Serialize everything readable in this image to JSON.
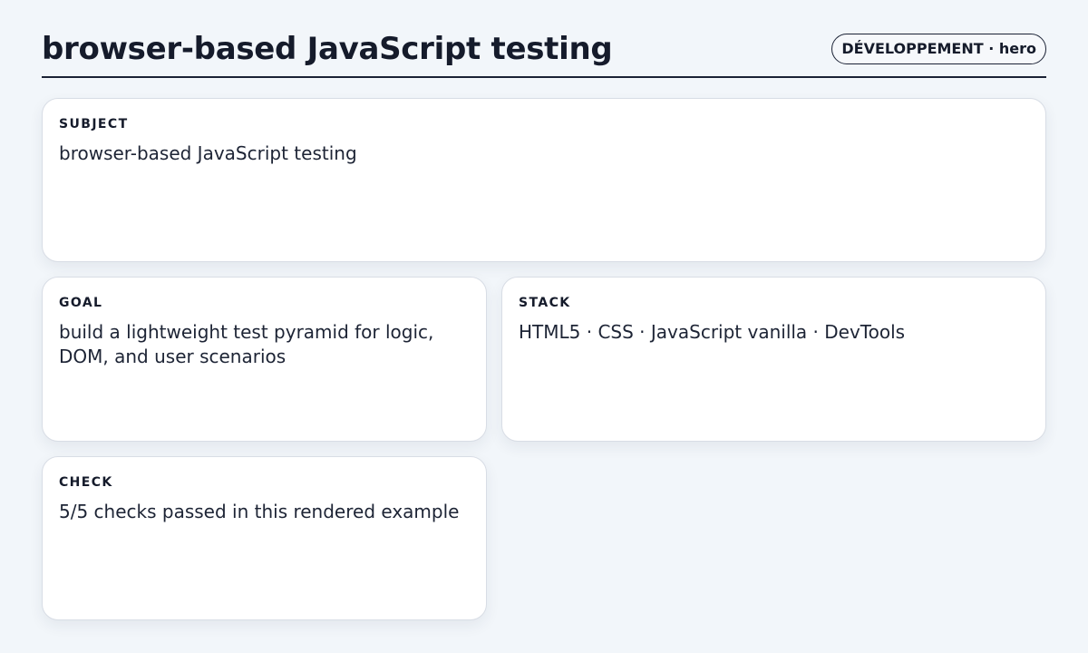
{
  "header": {
    "title": "browser-based JavaScript testing",
    "badge": "DÉVELOPPEMENT · hero"
  },
  "cards": {
    "subject": {
      "label": "SUBJECT",
      "value": "browser-based JavaScript testing"
    },
    "goal": {
      "label": "GOAL",
      "value": "build a lightweight test pyramid for logic, DOM, and user scenarios"
    },
    "stack": {
      "label": "STACK",
      "value": "HTML5 · CSS · JavaScript vanilla · DevTools"
    },
    "check": {
      "label": "CHECK",
      "value": "5/5 checks passed in this rendered example"
    }
  },
  "colors": {
    "background": "#f2f6fa",
    "card": "#ffffff",
    "text": "#151b2b",
    "border": "#d8dde5"
  }
}
